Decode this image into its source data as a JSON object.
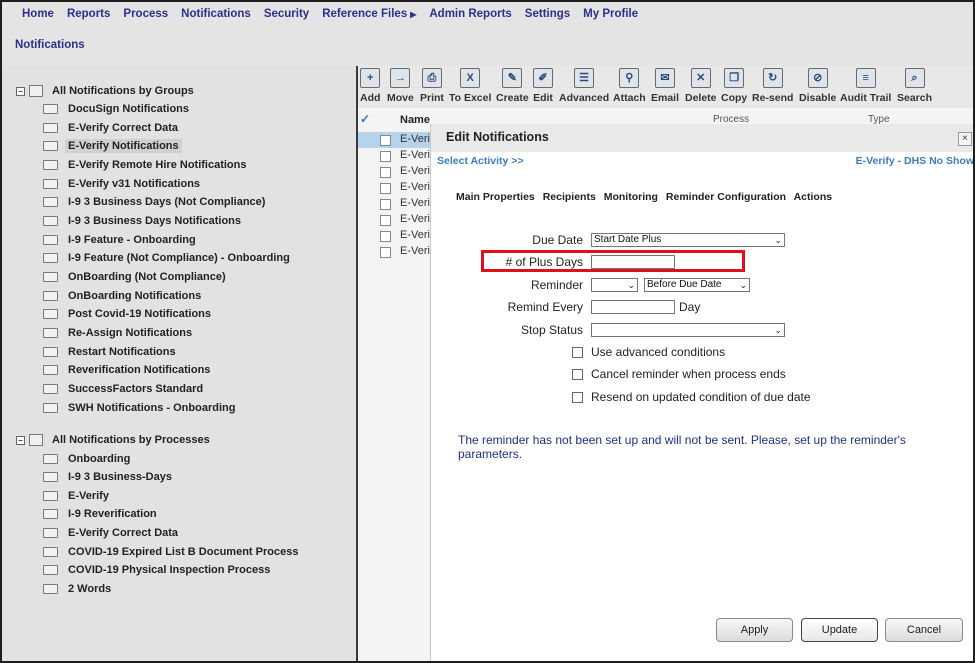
{
  "nav": {
    "items": [
      "Home",
      "Reports",
      "Process",
      "Notifications",
      "Security",
      "Reference Files",
      "Admin Reports",
      "Settings",
      "My Profile"
    ],
    "page_title": "Notifications"
  },
  "tree": {
    "groups_root": "All Notifications by Groups",
    "groups": [
      "DocuSign Notifications",
      "E-Verify Correct Data",
      "E-Verify Notifications",
      "E-Verify Remote Hire Notifications",
      "E-Verify v31 Notifications",
      "I-9 3 Business Days (Not Compliance)",
      "I-9 3 Business Days Notifications",
      "I-9 Feature - Onboarding",
      "I-9 Feature (Not Compliance) - Onboarding",
      "OnBoarding (Not Compliance)",
      "OnBoarding Notifications",
      "Post Covid-19 Notifications",
      "Re-Assign Notifications",
      "Restart Notifications",
      "Reverification Notifications",
      "SuccessFactors Standard",
      "SWH Notifications - Onboarding"
    ],
    "selected_group": "E-Verify Notifications",
    "processes_root": "All Notifications by Processes",
    "processes": [
      "Onboarding",
      "I-9 3 Business-Days",
      "E-Verify",
      "I-9 Reverification",
      "E-Verify Correct Data",
      "COVID-19 Expired List B Document Process",
      "COVID-19 Physical Inspection Process",
      "2 Words"
    ]
  },
  "toolbar": {
    "buttons": [
      {
        "label": "Add",
        "icon": "folder-add-icon"
      },
      {
        "label": "Move",
        "icon": "folder-move-icon"
      },
      {
        "label": "Print",
        "icon": "printer-icon"
      },
      {
        "label": "To Excel",
        "icon": "excel-icon"
      },
      {
        "label": "Create",
        "icon": "create-icon"
      },
      {
        "label": "Edit",
        "icon": "edit-icon"
      },
      {
        "label": "Advanced",
        "icon": "advanced-icon"
      },
      {
        "label": "Attach",
        "icon": "attach-icon"
      },
      {
        "label": "Email",
        "icon": "email-icon"
      },
      {
        "label": "Delete",
        "icon": "delete-icon"
      },
      {
        "label": "Copy",
        "icon": "copy-icon"
      },
      {
        "label": "Re-send",
        "icon": "resend-icon"
      },
      {
        "label": "Disable",
        "icon": "disable-icon"
      },
      {
        "label": "Audit Trail",
        "icon": "audit-trail-icon"
      },
      {
        "label": "Search",
        "icon": "search-icon"
      }
    ]
  },
  "grid": {
    "check_header": "✓",
    "name_header": "Name",
    "process_header": "Process",
    "type_header": "Type",
    "rows": [
      "E-Veri",
      "E-Veri",
      "E-Veri",
      "E-Veri",
      "E-Veri",
      "E-Veri",
      "E-Veri",
      "E-Veri"
    ]
  },
  "dialog": {
    "title": "Edit Notifications",
    "close": "×",
    "select_activity": "Select Activity >>",
    "activity_name": "E-Verify - DHS No Show",
    "tabs": [
      "Main Properties",
      "Recipients",
      "Monitoring",
      "Reminder Configuration",
      "Actions"
    ],
    "fields": {
      "due_date_label": "Due Date",
      "due_date_value": "Start Date Plus",
      "plus_days_label": "# of Plus Days",
      "plus_days_value": "",
      "reminder_label": "Reminder",
      "reminder_value": "",
      "reminder_when": "Before Due Date",
      "remind_every_label": "Remind Every",
      "remind_every_value": "",
      "remind_every_unit": "Day",
      "stop_status_label": "Stop Status",
      "stop_status_value": ""
    },
    "checkboxes": [
      {
        "label": "Use advanced conditions",
        "checked": false
      },
      {
        "label": "Cancel reminder when process ends",
        "checked": false
      },
      {
        "label": "Resend on updated condition of due date",
        "checked": false
      }
    ],
    "message": "The reminder has not been set up and will not be sent. Please, set up the reminder's parameters.",
    "buttons": {
      "apply": "Apply",
      "update": "Update",
      "cancel": "Cancel"
    }
  },
  "colors": {
    "nav_text": "#2e2f8c",
    "link_blue": "#3a7dc2",
    "message_text": "#1f2f8e",
    "highlight_box": "#e0101b",
    "selected_row": "#b6d3ec"
  }
}
